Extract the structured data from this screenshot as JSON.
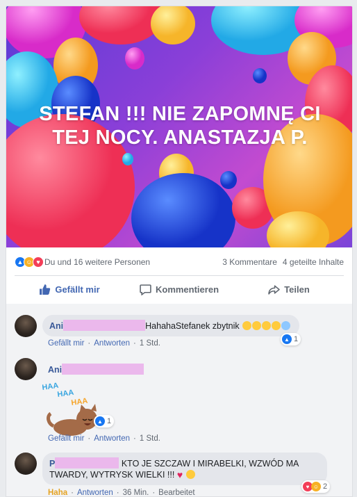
{
  "post": {
    "banner_text": "STEFAN !!! NIE ZAPOMNĘ CI TEJ NOCY. ANASTAZJA P.",
    "reactions_text": "Du und 16 weitere Personen",
    "comments_count": "3 Kommentare",
    "shares_count": "4 geteilte Inhalte"
  },
  "actions": {
    "like": "Gefällt mir",
    "comment": "Kommentieren",
    "share": "Teilen"
  },
  "comments": [
    {
      "name": "Ani",
      "text": "HahahaStefanek zbytnik",
      "reaction_count": "1",
      "like_label": "Gefällt mir",
      "reply_label": "Antworten",
      "time": "1 Std."
    },
    {
      "name": "Ani",
      "sticker_text": [
        "HAA",
        "HAA",
        "HAA"
      ],
      "reaction_count": "1",
      "like_label": "Gefällt mir",
      "reply_label": "Antworten",
      "time": "1 Std."
    },
    {
      "name": "P",
      "text": "KTO JE SZCZAW I MIRABELKI, WZWÓD MA TWARDY, WYTRYSK WIELKI !!!",
      "reaction_count": "2",
      "like_label": "Haha",
      "reply_label": "Antworten",
      "time": "36 Min.",
      "edited": "Bearbeitet"
    }
  ],
  "colors": {
    "link": "#4267b2",
    "name": "#385898",
    "redaction": "#ebb8ec",
    "haha": "#e5a323"
  }
}
